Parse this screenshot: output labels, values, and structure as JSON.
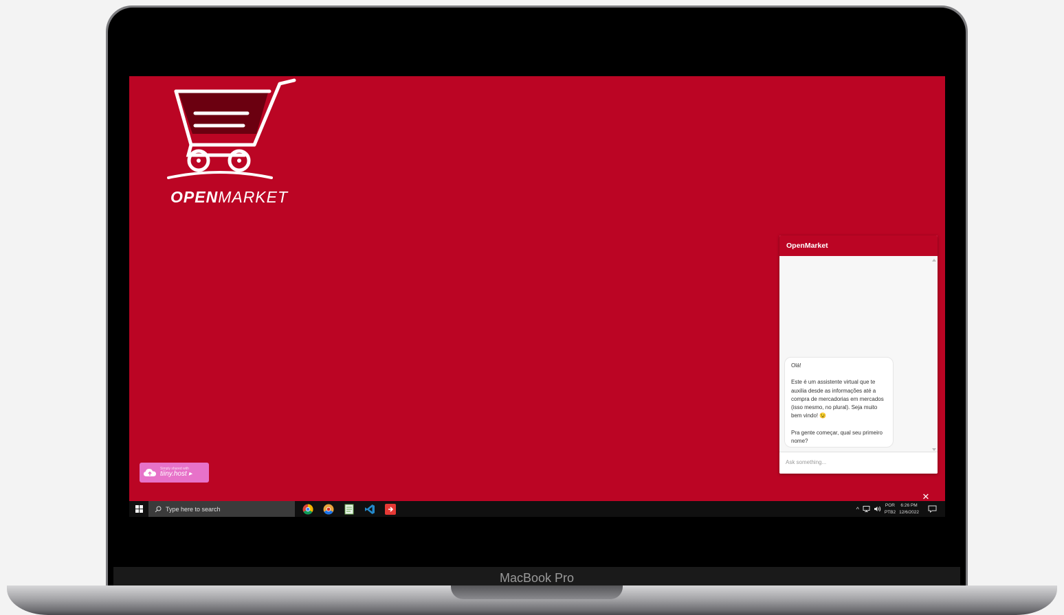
{
  "device": {
    "label": "MacBook Pro"
  },
  "brand": {
    "name_bold": "OPEN",
    "name_light": "MARKET",
    "color": "#bb0524"
  },
  "badge": {
    "small": "Simply shared with",
    "big": "tiiny.host ▸",
    "color": "#e772c9"
  },
  "chat": {
    "title": "OpenMarket",
    "message": "Olá!\n\nEste é um assistente virtual que te auxilia desde as informações até a compra de mercadorias em mercados (isso mesmo, no plural). Seja muito bem vindo! 😉\n\nPra gente começar, qual seu primeiro nome?",
    "input_placeholder": "Ask something...",
    "close_icon": "close-icon"
  },
  "taskbar": {
    "search_placeholder": "Type here to search",
    "apps": [
      "chrome-icon",
      "chrome-canary-icon",
      "notepad-icon",
      "vscode-icon",
      "remote-app-icon"
    ],
    "tray": {
      "chevron": "^",
      "lang_top": "POR",
      "lang_bottom": "PTB2",
      "time": "6:26 PM",
      "date": "12/6/2022"
    }
  }
}
